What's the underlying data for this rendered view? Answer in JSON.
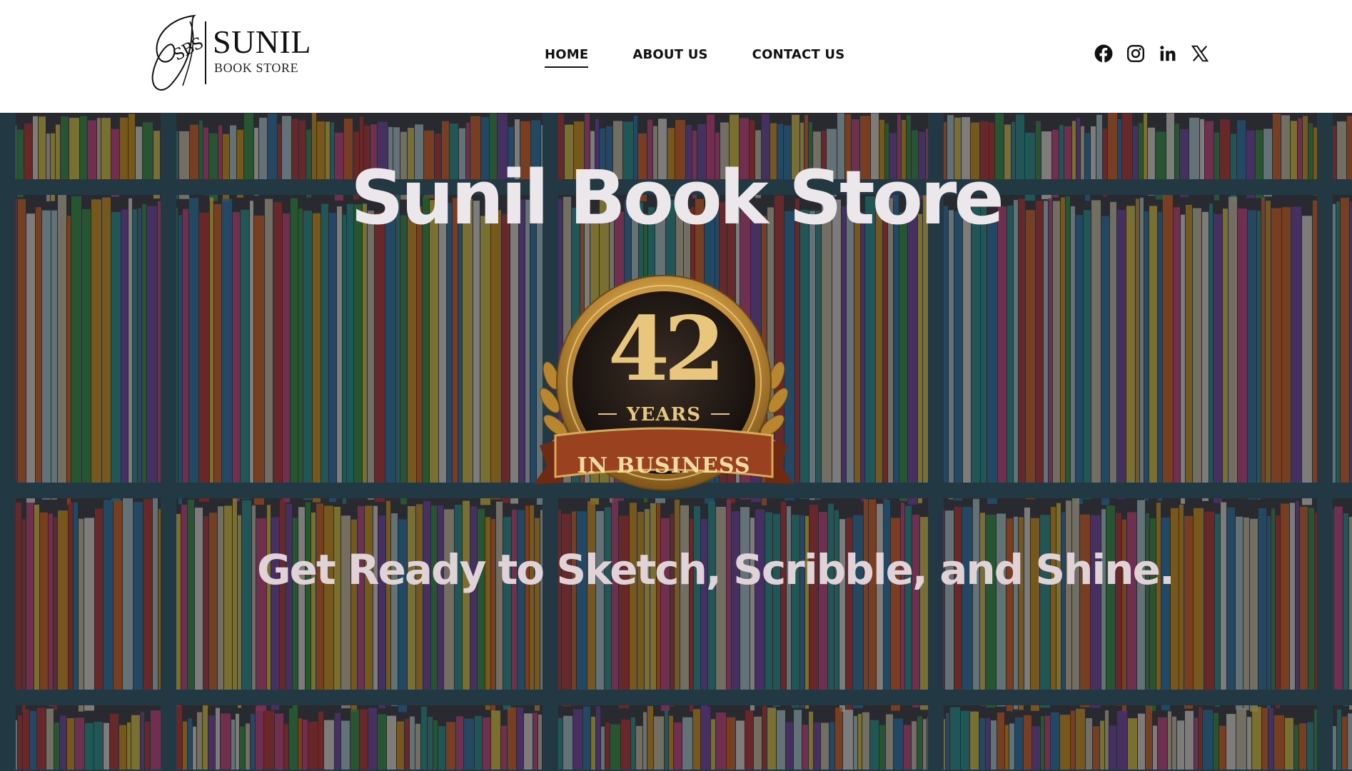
{
  "header": {
    "logo": {
      "monogram": "SBS",
      "name": "SUNIL",
      "subtitle": "BOOK STORE"
    },
    "nav": [
      {
        "label": "HOME",
        "active": true
      },
      {
        "label": "ABOUT US",
        "active": false
      },
      {
        "label": "CONTACT US",
        "active": false
      }
    ],
    "social": [
      "facebook-icon",
      "instagram-icon",
      "linkedin-icon",
      "x-icon"
    ]
  },
  "hero": {
    "title": "Sunil Book Store",
    "badge": {
      "number": "42",
      "years": "YEARS",
      "banner": "IN BUSINESS"
    },
    "subtitle": "Get Ready to Sketch, Scribble, and Shine."
  },
  "colors": {
    "header_bg": "#ffffff",
    "nav_text": "#111111",
    "hero_title": "#ece7ea",
    "hero_subtitle": "#e0d3d8",
    "badge_gold": "#e8c77c",
    "badge_ribbon": "#8e3b1d",
    "shelf": "#2f5a6a"
  }
}
